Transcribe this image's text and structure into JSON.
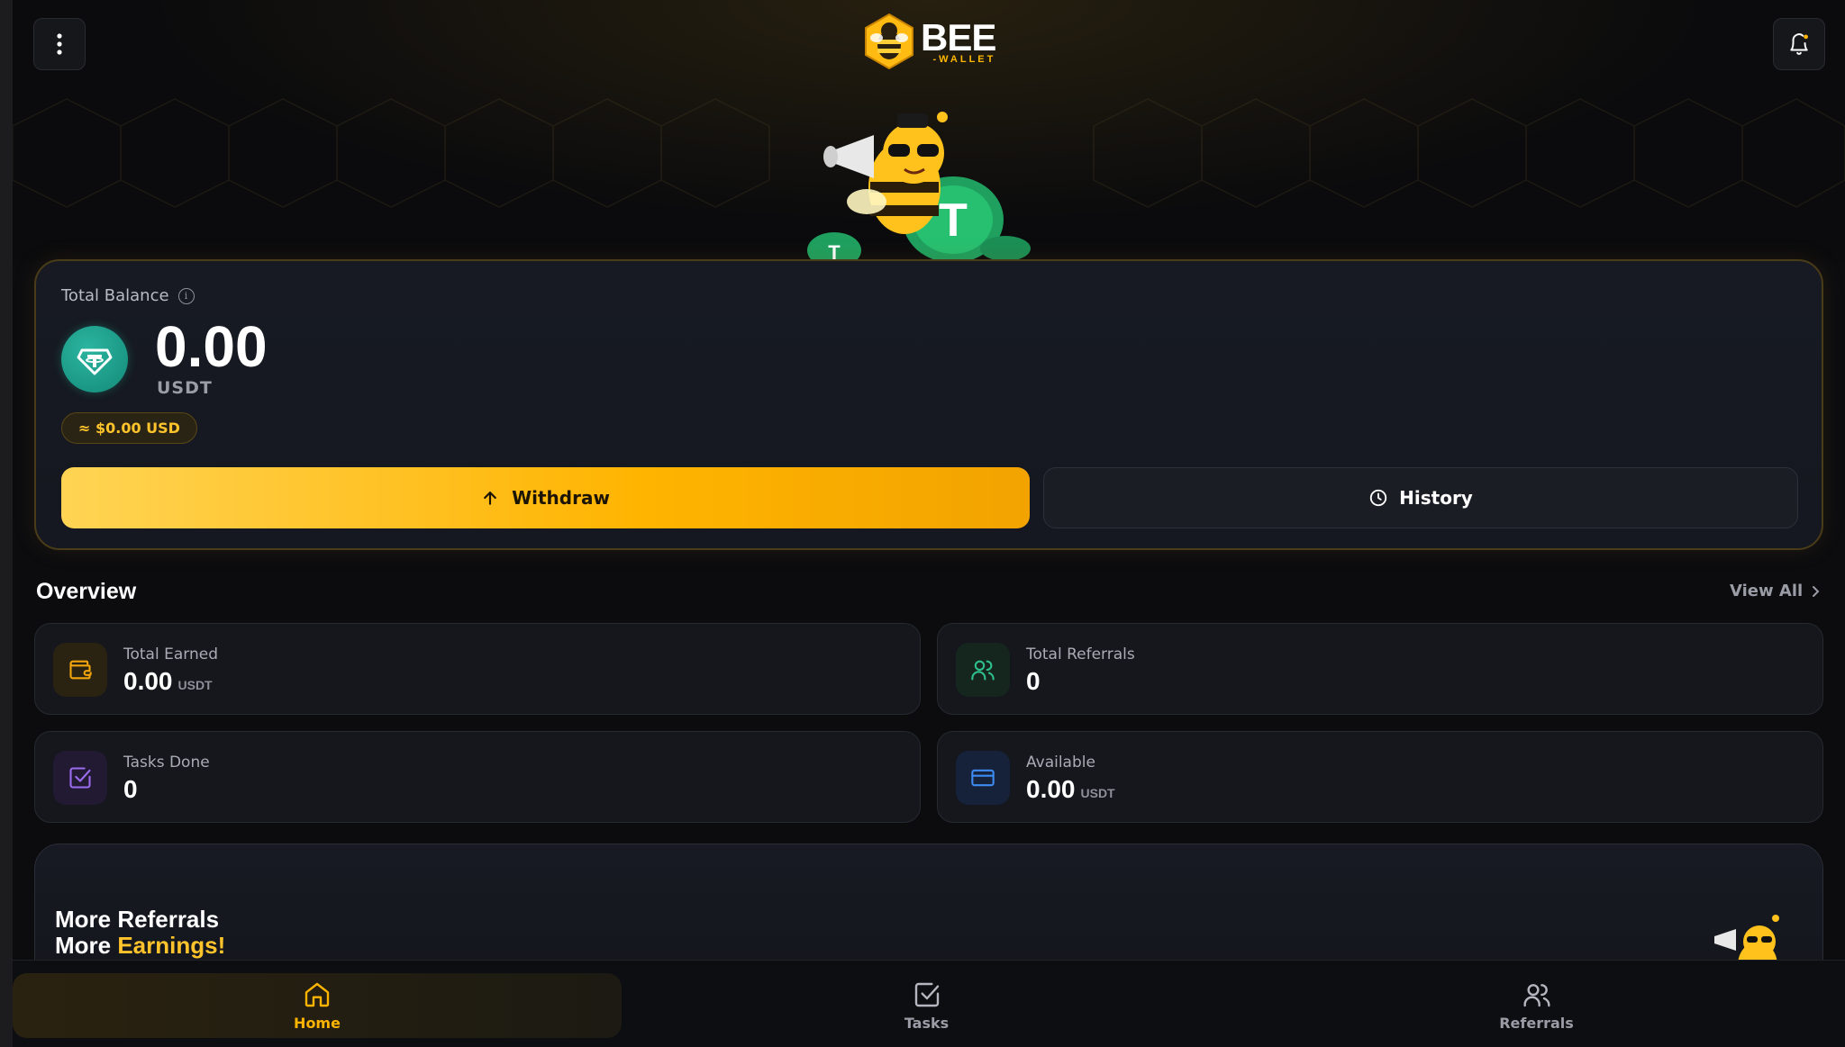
{
  "app": {
    "logo_main": "BEE",
    "logo_sub": "-WALLET"
  },
  "header": {
    "menu_icon": "more-vertical-icon",
    "bell_icon": "bell-icon"
  },
  "balance": {
    "label": "Total Balance",
    "amount": "0.00",
    "currency": "USDT",
    "usd_value": "≈ $0.00 USD",
    "withdraw_label": "Withdraw",
    "history_label": "History"
  },
  "overview": {
    "title": "Overview",
    "view_all": "View All",
    "stats": [
      {
        "label": "Total Earned",
        "value": "0.00",
        "unit": "USDT",
        "icon": "wallet-icon",
        "color": "#f2a60c"
      },
      {
        "label": "Total Referrals",
        "value": "0",
        "unit": "",
        "icon": "users-icon",
        "color": "#2fbf8f"
      },
      {
        "label": "Tasks Done",
        "value": "0",
        "unit": "",
        "icon": "check-square-icon",
        "color": "#9b6cf0"
      },
      {
        "label": "Available",
        "value": "0.00",
        "unit": "USDT",
        "icon": "credit-card-icon",
        "color": "#3d8bf2"
      }
    ]
  },
  "promo": {
    "line1": "More Referrals",
    "line2_prefix": "More ",
    "line2_accent": "Earnings!"
  },
  "nav": {
    "items": [
      {
        "label": "Home",
        "icon": "home-icon",
        "active": true
      },
      {
        "label": "Tasks",
        "icon": "check-square-icon",
        "active": false
      },
      {
        "label": "Referrals",
        "icon": "users-icon",
        "active": false
      }
    ]
  },
  "colors": {
    "accent": "#ffb400",
    "usdt": "#1a9e8a",
    "background": "#0c0c0f"
  }
}
